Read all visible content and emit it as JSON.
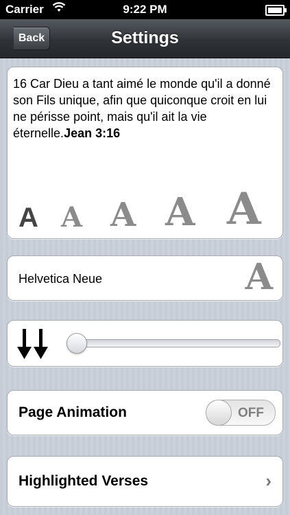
{
  "status_bar": {
    "carrier": "Carrier",
    "time": "9:22 PM",
    "wifi_icon": "wifi-icon",
    "battery_icon": "battery-icon"
  },
  "nav": {
    "title": "Settings",
    "back_label": "Back"
  },
  "verse": {
    "text": "16 Car Dieu a tant aimé le monde qu'il a donné son Fils unique, afin que quiconque croit en lui ne périsse point, mais qu'il ait la vie éternelle.",
    "reference": "Jean 3:16"
  },
  "font_sizes": {
    "glyph": "A",
    "options": [
      "A",
      "A",
      "A",
      "A",
      "A"
    ],
    "selected_index": 0,
    "selected_color": "#444444",
    "unselected_color": "#8b8b8b"
  },
  "font": {
    "name": "Helvetica Neue",
    "preview_glyph": "A"
  },
  "spacing": {
    "icon": "line-spacing-arrows-icon",
    "slider_value": 0
  },
  "page_animation": {
    "label": "Page Animation",
    "toggle_state": "OFF"
  },
  "highlighted": {
    "label": "Highlighted Verses",
    "chevron": "›"
  }
}
